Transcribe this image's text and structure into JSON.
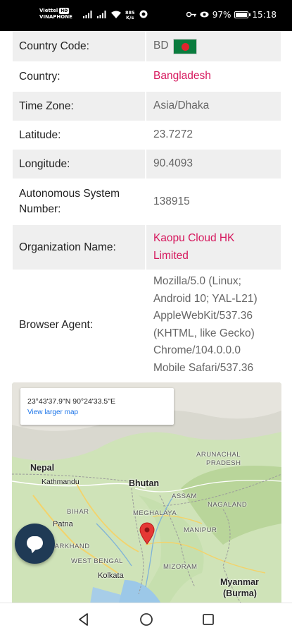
{
  "status_bar": {
    "carrier_1": "Viettel",
    "carrier_badge": "HD",
    "carrier_2": "VINAPHONE",
    "net_speed_value": "885",
    "net_speed_unit": "K/s",
    "battery_percent": "97%",
    "battery_level": 0.97,
    "time": "15:18"
  },
  "info_rows": [
    {
      "label": "Country Code:",
      "value": "BD",
      "style": "normal",
      "flag": true
    },
    {
      "label": "Country:",
      "value": "Bangladesh",
      "style": "pink"
    },
    {
      "label": "Time Zone:",
      "value": "Asia/Dhaka",
      "style": "normal"
    },
    {
      "label": "Latitude:",
      "value": "23.7272",
      "style": "normal"
    },
    {
      "label": "Longitude:",
      "value": "90.4093",
      "style": "normal"
    },
    {
      "label": "Autonomous System Number:",
      "value": "138915",
      "style": "normal"
    },
    {
      "label": "Organization Name:",
      "value": "Kaopu Cloud HK Limited",
      "style": "pink"
    },
    {
      "label": "Browser Agent:",
      "value": "Mozilla/5.0 (Linux; Android 10; YAL-L21) AppleWebKit/537.36 (KHTML, like Gecko) Chrome/104.0.0.0 Mobile Safari/537.36",
      "style": "normal"
    }
  ],
  "map": {
    "coords": "23°43'37.9\"N 90°24'33.5\"E",
    "link": "View larger map",
    "labels": {
      "nepal": "Nepal",
      "kathmandu": "Kathmandu",
      "bhutan": "Bhutan",
      "arunachal": "ARUNACHAL",
      "pradesh": "PRADESH",
      "assam": "ASSAM",
      "nagaland": "NAGALAND",
      "meghalaya": "MEGHALAYA",
      "bihar": "BIHAR",
      "patna": "Patna",
      "manipur": "MANIPUR",
      "jharkhand": "JHARKHAND",
      "west_bengal": "WEST BENGAL",
      "mizoram": "MIZORAM",
      "kolkata": "Kolkata",
      "myanmar": "Myanmar",
      "burma": "(Burma)"
    }
  },
  "colors": {
    "accent_pink": "#d6175d",
    "row_gray": "#efefef",
    "chat_button": "#1f3a55",
    "link_blue": "#1a73e8"
  }
}
